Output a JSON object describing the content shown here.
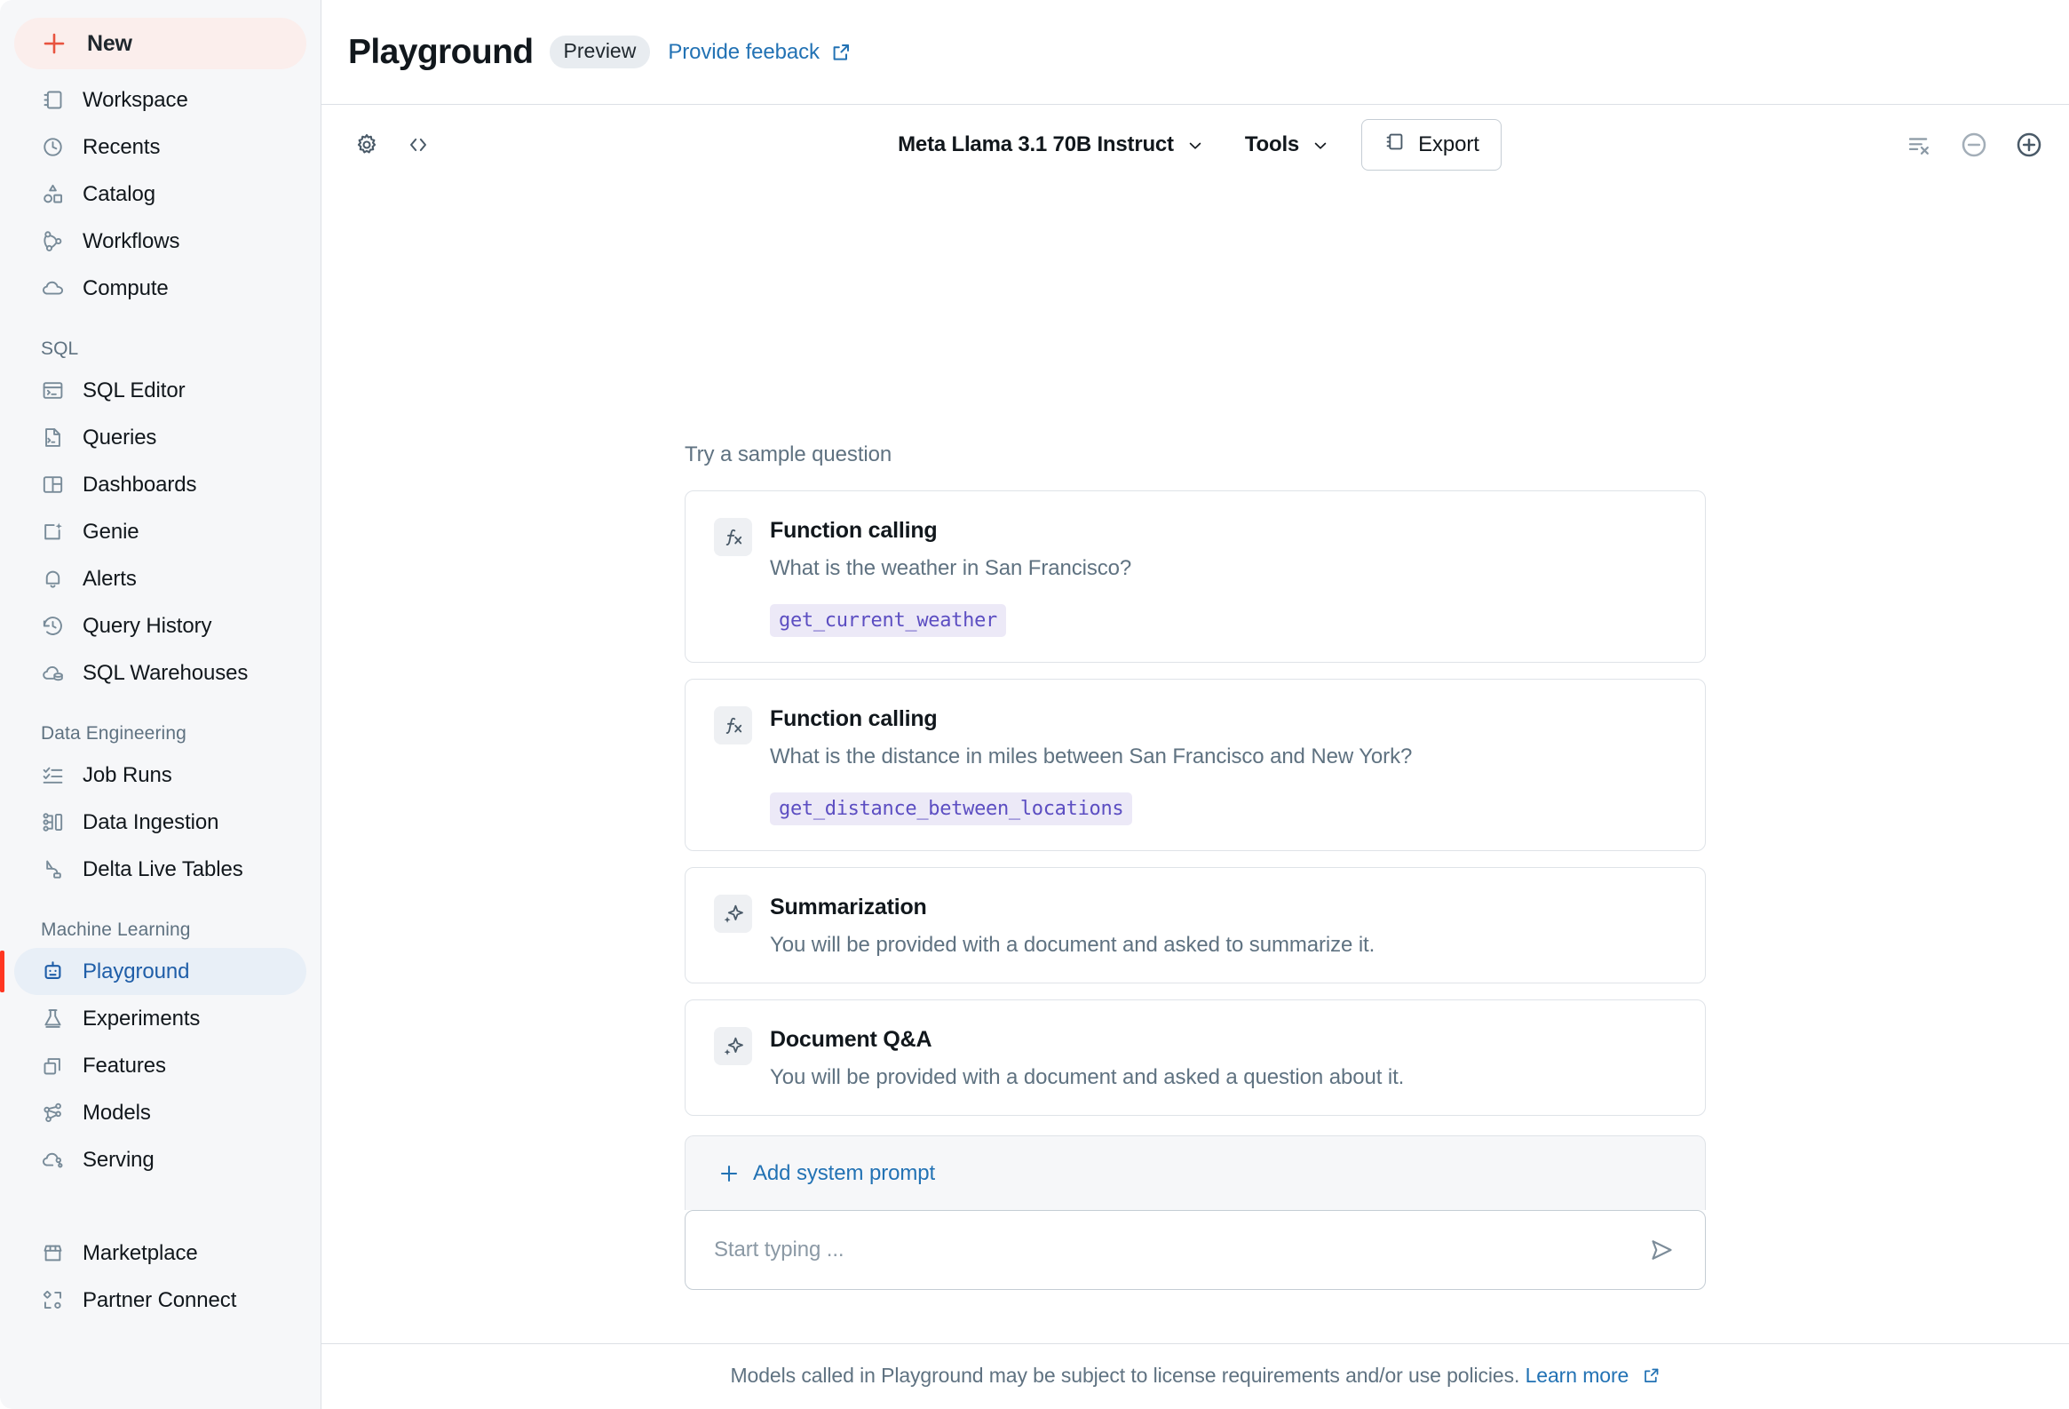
{
  "sidebar": {
    "new_button": {
      "label": "New",
      "icon": "plus-icon"
    },
    "top_items": [
      {
        "label": "Workspace",
        "icon": "workspace-icon"
      },
      {
        "label": "Recents",
        "icon": "clock-icon"
      },
      {
        "label": "Catalog",
        "icon": "shapes-icon"
      },
      {
        "label": "Workflows",
        "icon": "workflows-icon"
      },
      {
        "label": "Compute",
        "icon": "cloud-icon"
      }
    ],
    "sections": [
      {
        "label": "SQL",
        "items": [
          {
            "label": "SQL Editor",
            "icon": "sql-editor-icon"
          },
          {
            "label": "Queries",
            "icon": "query-file-icon"
          },
          {
            "label": "Dashboards",
            "icon": "dashboard-grid-icon"
          },
          {
            "label": "Genie",
            "icon": "genie-sparkle-icon"
          },
          {
            "label": "Alerts",
            "icon": "bell-icon"
          },
          {
            "label": "Query History",
            "icon": "history-clock-icon"
          },
          {
            "label": "SQL Warehouses",
            "icon": "warehouse-cloud-icon"
          }
        ]
      },
      {
        "label": "Data Engineering",
        "items": [
          {
            "label": "Job Runs",
            "icon": "checklist-icon"
          },
          {
            "label": "Data Ingestion",
            "icon": "ingestion-icon"
          },
          {
            "label": "Delta Live Tables",
            "icon": "delta-live-tables-icon"
          }
        ]
      },
      {
        "label": "Machine Learning",
        "items": [
          {
            "label": "Playground",
            "icon": "robot-icon",
            "active": true
          },
          {
            "label": "Experiments",
            "icon": "flask-icon"
          },
          {
            "label": "Features",
            "icon": "features-icon"
          },
          {
            "label": "Models",
            "icon": "models-graph-icon"
          },
          {
            "label": "Serving",
            "icon": "serving-cloud-icon"
          }
        ]
      }
    ],
    "bottom_items": [
      {
        "label": "Marketplace",
        "icon": "storefront-icon"
      },
      {
        "label": "Partner Connect",
        "icon": "partner-connect-icon"
      }
    ]
  },
  "header": {
    "title": "Playground",
    "preview_badge": "Preview",
    "feedback_link": "Provide feeback"
  },
  "toolbar": {
    "settings_icon": "gear-icon",
    "code_icon": "code-brackets-icon",
    "model": "Meta Llama 3.1 70B Instruct",
    "tools": "Tools",
    "export": "Export",
    "clear_icon": "clear-history-icon",
    "remove_icon": "minus-circle-icon",
    "add_icon": "plus-circle-icon"
  },
  "main": {
    "samples_heading": "Try a sample question",
    "samples": [
      {
        "icon": "fx-icon",
        "title": "Function calling",
        "description": "What is the weather in San Francisco?",
        "tag": "get_current_weather"
      },
      {
        "icon": "fx-icon",
        "title": "Function calling",
        "description": "What is the distance in miles between San Francisco and New York?",
        "tag": "get_distance_between_locations"
      },
      {
        "icon": "sparkle-icon",
        "title": "Summarization",
        "description": "You will be provided with a document and asked to summarize it.",
        "tag": ""
      },
      {
        "icon": "sparkle-icon",
        "title": "Document Q&A",
        "description": "You will be provided with a document and asked a question about it.",
        "tag": ""
      }
    ]
  },
  "composer": {
    "add_system_prompt": "Add system prompt",
    "input_value": "",
    "input_placeholder": "Start typing ...",
    "send_icon": "send-icon"
  },
  "footer": {
    "text": "Models called in Playground may be subject to license requirements and/or use policies.",
    "link": "Learn more"
  },
  "colors": {
    "accent_red": "#FF3621",
    "link_blue": "#2272B4",
    "active_bg": "#E8EFF7",
    "new_bg": "#FBEEEC",
    "tag_bg": "#ECE9F7",
    "tag_text": "#5C4EC2",
    "sidebar_bg": "#F6F7F9",
    "border": "#DCE0E5"
  }
}
